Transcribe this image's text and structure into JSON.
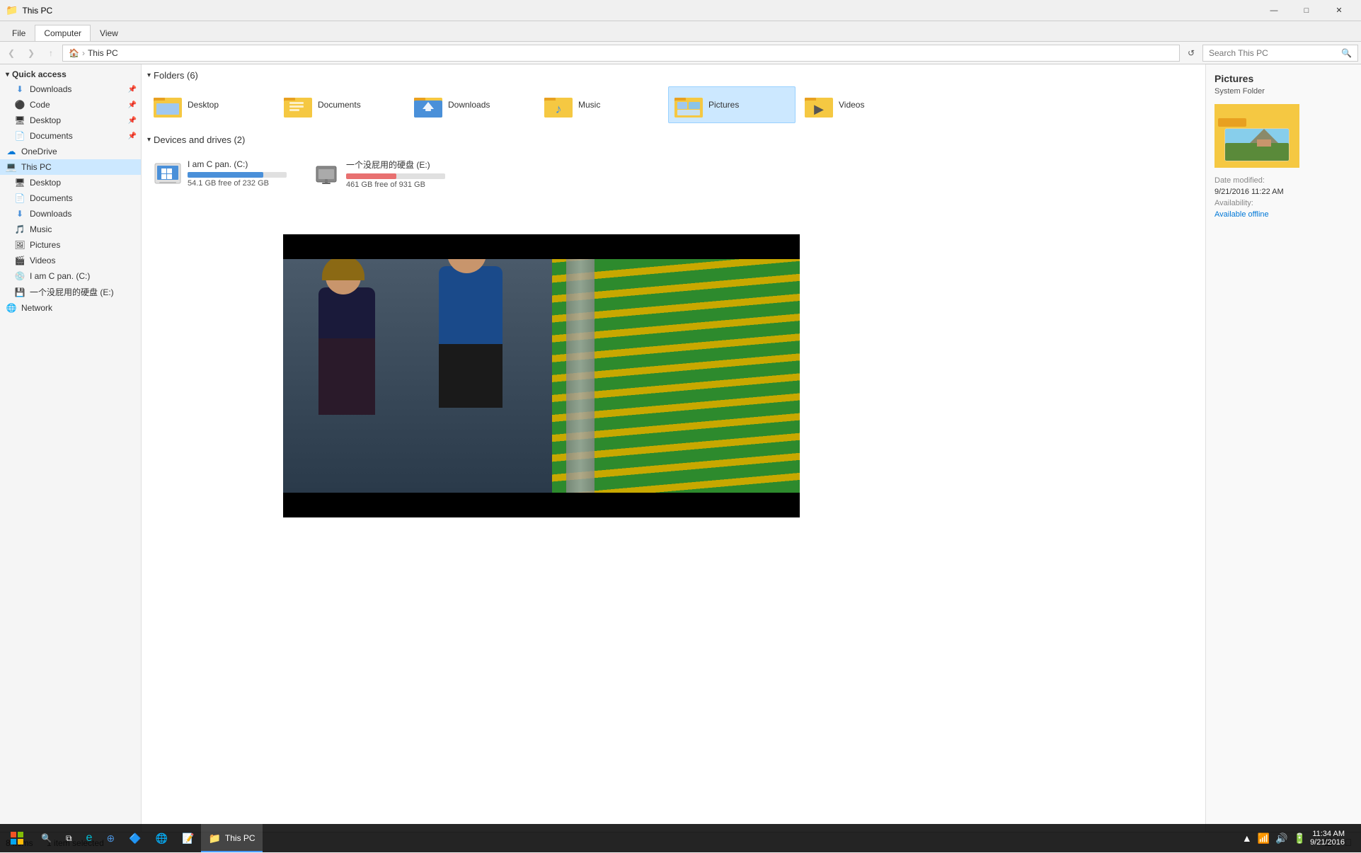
{
  "titleBar": {
    "title": "This PC",
    "icon": "📁",
    "controls": [
      "minimize",
      "maximize",
      "close"
    ]
  },
  "ribbon": {
    "tabs": [
      "File",
      "Computer",
      "View"
    ],
    "activeTab": "Computer"
  },
  "addressBar": {
    "path": "This PC",
    "breadcrumbs": [
      "This PC"
    ],
    "searchPlaceholder": "Search This PC"
  },
  "sidebar": {
    "sections": [
      {
        "name": "quickAccess",
        "label": "Quick access",
        "expanded": true,
        "items": [
          {
            "id": "downloads-quick",
            "label": "Downloads",
            "icon": "downloads",
            "pinned": true
          },
          {
            "id": "code",
            "label": "Code",
            "icon": "folder",
            "pinned": true
          },
          {
            "id": "desktop-quick",
            "label": "Desktop",
            "icon": "folder",
            "pinned": true
          },
          {
            "id": "documents-quick",
            "label": "Documents",
            "icon": "folder",
            "pinned": true
          }
        ]
      },
      {
        "name": "onedrive",
        "label": "OneDrive",
        "icon": "cloud"
      },
      {
        "name": "thisPC",
        "label": "This PC",
        "selected": true,
        "expanded": true,
        "items": [
          {
            "id": "desktop-pc",
            "label": "Desktop",
            "icon": "desktop"
          },
          {
            "id": "documents-pc",
            "label": "Documents",
            "icon": "documents"
          },
          {
            "id": "downloads-pc",
            "label": "Downloads",
            "icon": "downloads"
          },
          {
            "id": "music-pc",
            "label": "Music",
            "icon": "music"
          },
          {
            "id": "pictures-pc",
            "label": "Pictures",
            "icon": "pictures"
          },
          {
            "id": "videos-pc",
            "label": "Videos",
            "icon": "videos"
          },
          {
            "id": "drive-c",
            "label": "I am C pan. (C:)",
            "icon": "drive"
          },
          {
            "id": "drive-e",
            "label": "一个没屁用的硬盘 (E:)",
            "icon": "drive-e"
          }
        ]
      },
      {
        "name": "network",
        "label": "Network",
        "icon": "network"
      }
    ]
  },
  "content": {
    "foldersSection": {
      "label": "Folders (6)",
      "folders": [
        {
          "id": "desktop",
          "name": "Desktop",
          "icon": "folder-desktop"
        },
        {
          "id": "documents",
          "name": "Documents",
          "icon": "folder-documents"
        },
        {
          "id": "downloads",
          "name": "Downloads",
          "icon": "folder-downloads"
        },
        {
          "id": "music",
          "name": "Music",
          "icon": "folder-music"
        },
        {
          "id": "pictures",
          "name": "Pictures",
          "icon": "folder-pictures",
          "selected": true
        },
        {
          "id": "videos",
          "name": "Videos",
          "icon": "folder-videos"
        }
      ]
    },
    "devicesSection": {
      "label": "Devices and drives (2)",
      "devices": [
        {
          "id": "drive-c",
          "name": "I am C pan. (C:)",
          "icon": "windows-drive",
          "freeGB": 54.1,
          "totalGB": 232,
          "usedPercent": 76.7,
          "freeText": "54.1 GB free of 232 GB",
          "barColor": "#4a90d9"
        },
        {
          "id": "drive-e",
          "name": "一个没屁用的硬盘 (E:)",
          "icon": "external-drive",
          "freeGB": 461,
          "totalGB": 931,
          "usedPercent": 50.5,
          "freeText": "461 GB free of 931 GB",
          "barColor": "#4a90d9"
        }
      ]
    }
  },
  "previewPane": {
    "title": "Pictures",
    "subtitle": "System Folder",
    "dateModifiedLabel": "Date modified:",
    "dateModifiedValue": "9/21/2016 11:22 AM",
    "availabilityLabel": "Availability:",
    "availabilityValue": "Available offline",
    "availabilityColor": "#0078d7"
  },
  "statusBar": {
    "itemCount": "8 items",
    "selectedInfo": "1 item selected"
  },
  "taskbar": {
    "time": "11:34 AM",
    "date": "9/21/2016",
    "items": [
      {
        "id": "start",
        "label": "⊞"
      },
      {
        "id": "search",
        "label": "🔍"
      },
      {
        "id": "taskview",
        "label": "⧉"
      },
      {
        "id": "edge",
        "label": "Edge"
      },
      {
        "id": "ie",
        "label": "IE"
      },
      {
        "id": "explorer",
        "label": "This PC",
        "active": true
      }
    ]
  }
}
